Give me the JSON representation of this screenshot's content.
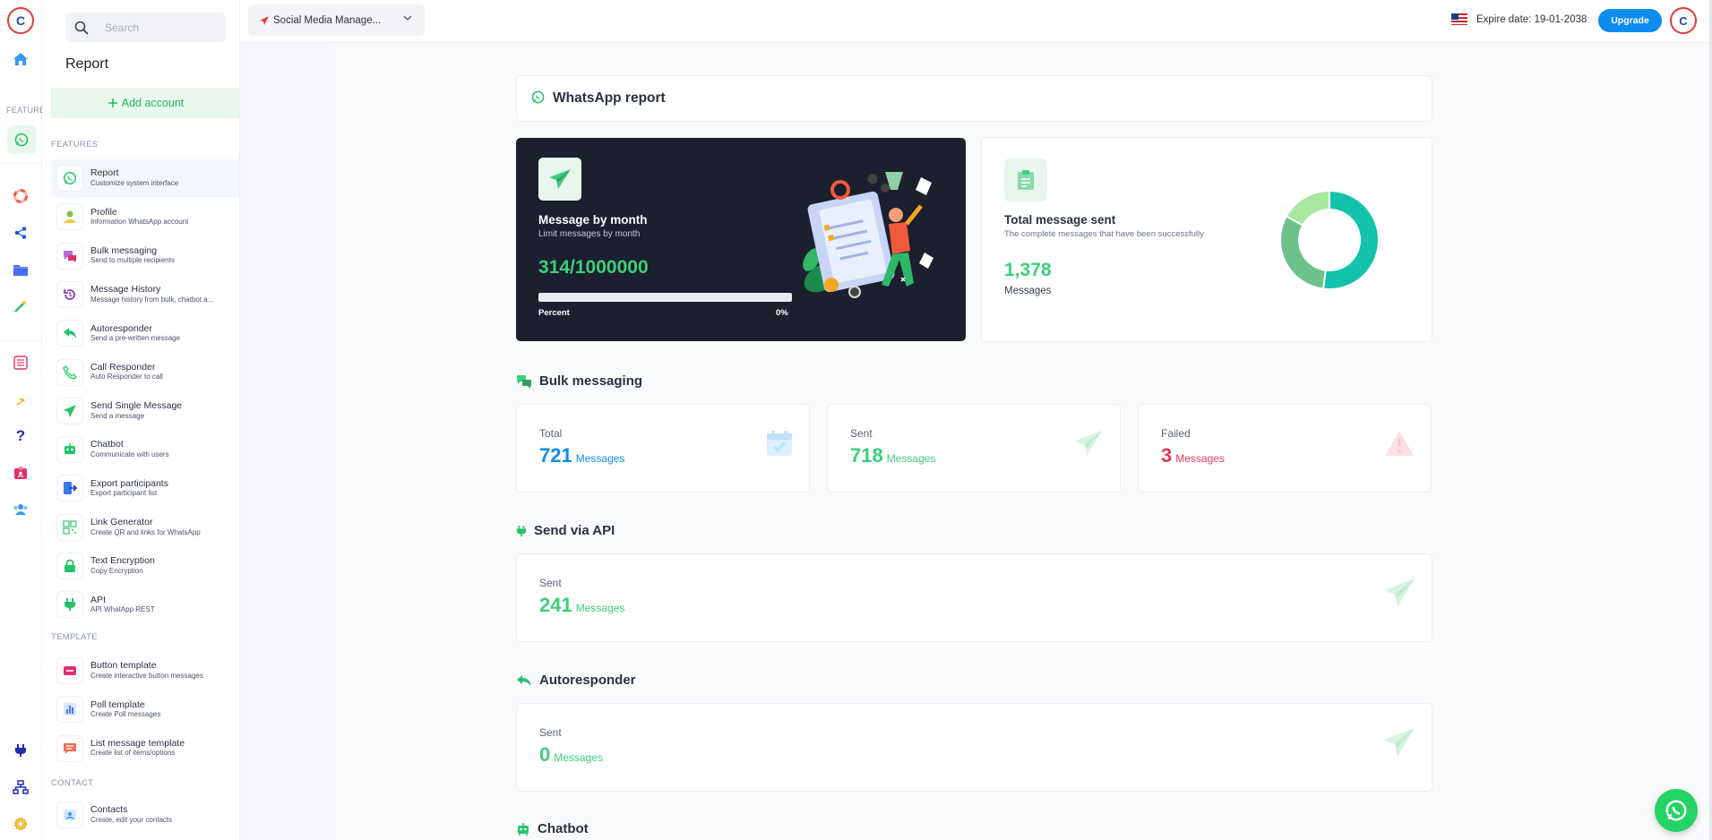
{
  "app": {
    "project_label": "Social Media Manage...",
    "expire_text": "Expire date: 19-01-2038",
    "upgrade_label": "Upgrade"
  },
  "rail": {
    "features_heading": "FEATURES",
    "icons": [
      "home-icon",
      "whatsapp-icon",
      "lifebuoy-icon",
      "share-icon",
      "folder-icon",
      "magic-wand-icon",
      "list-icon",
      "bing-icon",
      "help-icon",
      "id-badge-icon",
      "users-icon",
      "plug-icon",
      "sitemap-icon",
      "gear-icon"
    ]
  },
  "sidebar": {
    "search_placeholder": "Search",
    "title": "Report",
    "add_account": "Add account",
    "features_heading": "FEATURES",
    "template_heading": "TEMPLATE",
    "contact_heading": "CONTACT",
    "features": [
      {
        "label": "Report",
        "sub": "Customize system interface",
        "icon": "whatsapp-icon",
        "color": "#25c46a"
      },
      {
        "label": "Profile",
        "sub": "Information WhatsApp account",
        "icon": "user-icon",
        "color": "#7cc24a"
      },
      {
        "label": "Bulk messaging",
        "sub": "Send to multiple recipients",
        "icon": "chat-bubbles-icon",
        "color": "#b46ad8"
      },
      {
        "label": "Message History",
        "sub": "Message history from bulk, chatbot a...",
        "icon": "history-icon",
        "color": "#8e44ad"
      },
      {
        "label": "Autoresponder",
        "sub": "Send a pre-written message",
        "icon": "reply-icon",
        "color": "#25c46a"
      },
      {
        "label": "Call Responder",
        "sub": "Auto Responder to call",
        "icon": "phone-icon",
        "color": "#3ccf7a"
      },
      {
        "label": "Send Single Message",
        "sub": "Send a message",
        "icon": "paper-plane-icon",
        "color": "#25c46a"
      },
      {
        "label": "Chatbot",
        "sub": "Communicate with users",
        "icon": "robot-icon",
        "color": "#25c46a"
      },
      {
        "label": "Export participants",
        "sub": "Export participant list",
        "icon": "export-icon",
        "color": "#3a7bf0"
      },
      {
        "label": "Link Generator",
        "sub": "Create QR and links for WhatsApp",
        "icon": "qr-code-icon",
        "color": "#5bd08a"
      },
      {
        "label": "Text Encryption",
        "sub": "Copy Encryption",
        "icon": "lock-icon",
        "color": "#25c46a"
      },
      {
        "label": "API",
        "sub": "API WhatApp REST",
        "icon": "plug-icon",
        "color": "#25c46a"
      }
    ],
    "templates": [
      {
        "label": "Button template",
        "sub": "Create interactive button messages",
        "icon": "button-template-icon",
        "color": "#e0316d"
      },
      {
        "label": "Poll template",
        "sub": "Create Poll messages",
        "icon": "poll-icon",
        "color": "#3a7bf0"
      },
      {
        "label": "List message template",
        "sub": "Create list of items/options",
        "icon": "list-message-icon",
        "color": "#f06e55"
      }
    ],
    "contacts": [
      {
        "label": "Contacts",
        "sub": "Create, edit your contacts",
        "icon": "contact-card-icon",
        "color": "#3a9af0"
      }
    ]
  },
  "report": {
    "title": "WhatsApp report",
    "month_card": {
      "title": "Message by month",
      "subtitle": "Limit messages by month",
      "count": "314/1000000",
      "percent_label": "Percent",
      "percent_value": "0%",
      "progress": 0
    },
    "total_card": {
      "title": "Total message sent",
      "subtitle": "The complete messages that have been successfully",
      "count": "1,378",
      "unit": "Messages",
      "donut": [
        {
          "value": 52,
          "color": "#13c2aa"
        },
        {
          "value": 31,
          "color": "#6dc28a"
        },
        {
          "value": 17,
          "color": "#a8e8a0"
        }
      ]
    },
    "bulk": {
      "title": "Bulk messaging",
      "stats": [
        {
          "label": "Total",
          "value": "721",
          "unit": "Messages",
          "color": "#0d8cf0",
          "icon": "calendar-check-icon"
        },
        {
          "label": "Sent",
          "value": "718",
          "unit": "Messages",
          "color": "#3ccf7a",
          "icon": "paper-plane-icon"
        },
        {
          "label": "Failed",
          "value": "3",
          "unit": "Messages",
          "color": "#e53955",
          "icon": "warning-icon"
        }
      ]
    },
    "api": {
      "title": "Send via API",
      "label": "Sent",
      "value": "241",
      "unit": "Messages"
    },
    "autoresponder": {
      "title": "Autoresponder",
      "label": "Sent",
      "value": "0",
      "unit": "Messages"
    },
    "chatbot": {
      "title": "Chatbot"
    }
  }
}
